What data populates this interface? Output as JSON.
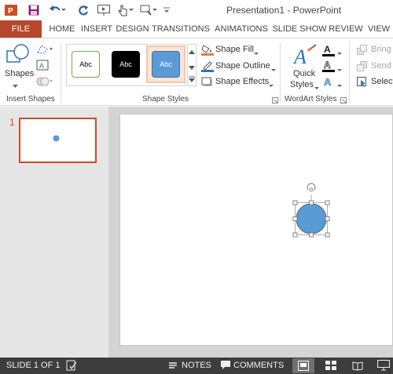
{
  "window": {
    "title": "Presentation1 - PowerPoint"
  },
  "quick_access": {
    "icons": [
      "powerpoint-logo-icon",
      "save-icon",
      "undo-icon",
      "redo-icon",
      "slideshow-from-beginning-icon",
      "touch-mode-icon",
      "customize-icon"
    ]
  },
  "ribbon": {
    "tabs": [
      "FILE",
      "HOME",
      "INSERT",
      "DESIGN",
      "TRANSITIONS",
      "ANIMATIONS",
      "SLIDE SHOW",
      "REVIEW",
      "VIEW"
    ],
    "active_tab": "FILE",
    "insert_shapes": {
      "shapes_label": "Shapes",
      "group_label": "Insert Shapes"
    },
    "shape_styles": {
      "tiles": [
        {
          "label": "Abc",
          "fill": "#ffffff",
          "border": "#70ad47",
          "text": "#000000"
        },
        {
          "label": "Abc",
          "fill": "#000000",
          "border": "#000000",
          "text": "#ffffff"
        },
        {
          "label": "Abc",
          "fill": "#5b9bd5",
          "border": "#41719c",
          "text": "#ffffff"
        }
      ],
      "selected_tile": 2,
      "commands": {
        "fill": "Shape Fill",
        "outline": "Shape Outline",
        "effects": "Shape Effects"
      },
      "group_label": "Shape Styles"
    },
    "wordart": {
      "quick_label_1": "Quick",
      "quick_label_2": "Styles",
      "group_label": "WordArt Styles"
    },
    "arrange": {
      "bring": "Bring",
      "send": "Send",
      "select": "Select"
    }
  },
  "thumbnails": {
    "slide_number": "1"
  },
  "slide": {
    "shape_fill": "#5b9bd5",
    "shape_outline": "#41719c"
  },
  "status": {
    "slide_info": "SLIDE 1 OF 1",
    "notes": "NOTES",
    "comments": "COMMENTS"
  },
  "colors": {
    "accent": "#b7472a",
    "thumb_border": "#d04a25",
    "status_bg": "#3d3d3d"
  }
}
